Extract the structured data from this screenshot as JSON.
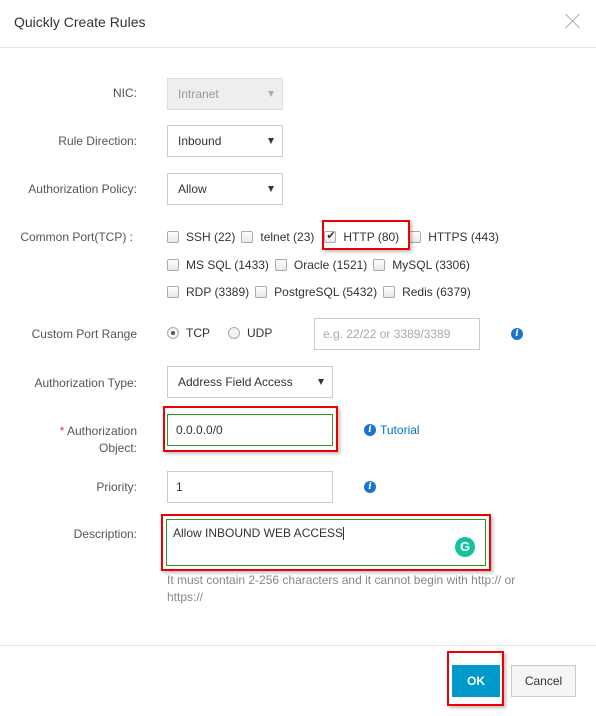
{
  "dialog": {
    "title": "Quickly Create Rules",
    "close_icon": "close-icon"
  },
  "form": {
    "nic": {
      "label": "NIC:",
      "value": "Intranet",
      "disabled": true
    },
    "rule_direction": {
      "label": "Rule Direction:",
      "value": "Inbound"
    },
    "authorization_policy": {
      "label": "Authorization Policy:",
      "value": "Allow"
    },
    "common_port": {
      "label": "Common Port(TCP) :",
      "rows": [
        [
          {
            "label": "SSH (22)",
            "checked": false
          },
          {
            "label": "telnet (23)",
            "checked": false
          },
          {
            "label": "HTTP (80)",
            "checked": true
          },
          {
            "label": "HTTPS (443)",
            "checked": false
          }
        ],
        [
          {
            "label": "MS SQL (1433)",
            "checked": false
          },
          {
            "label": "Oracle (1521)",
            "checked": false
          },
          {
            "label": "MySQL (3306)",
            "checked": false
          }
        ],
        [
          {
            "label": "RDP (3389)",
            "checked": false
          },
          {
            "label": "PostgreSQL (5432)",
            "checked": false
          },
          {
            "label": "Redis (6379)",
            "checked": false
          }
        ]
      ]
    },
    "custom_port_range": {
      "label": "Custom Port Range",
      "protocols": [
        {
          "label": "TCP",
          "selected": true
        },
        {
          "label": "UDP",
          "selected": false
        }
      ],
      "placeholder": "e.g. 22/22 or 3389/3389",
      "value": ""
    },
    "authorization_type": {
      "label": "Authorization Type:",
      "value": "Address Field Access"
    },
    "authorization_object": {
      "required_mark": "*",
      "label_line1": "Authorization",
      "label_line2": "Object:",
      "value": "0.0.0.0/0",
      "tutorial_link": "Tutorial"
    },
    "priority": {
      "label": "Priority:",
      "value": "1"
    },
    "description": {
      "label": "Description:",
      "value": "Allow INBOUND WEB ACCESS",
      "help_text": "It must contain 2-256 characters and it cannot begin with http:// or https://",
      "grammarly_glyph": "G"
    }
  },
  "footer": {
    "ok_label": "OK",
    "cancel_label": "Cancel"
  },
  "colors": {
    "primary_button": "#0099cc",
    "annotation_highlight": "#ee0000",
    "valid_border": "#2a9a2a",
    "info_icon": "#1b75d0",
    "link": "#0073cc",
    "required": "#e4393c"
  }
}
